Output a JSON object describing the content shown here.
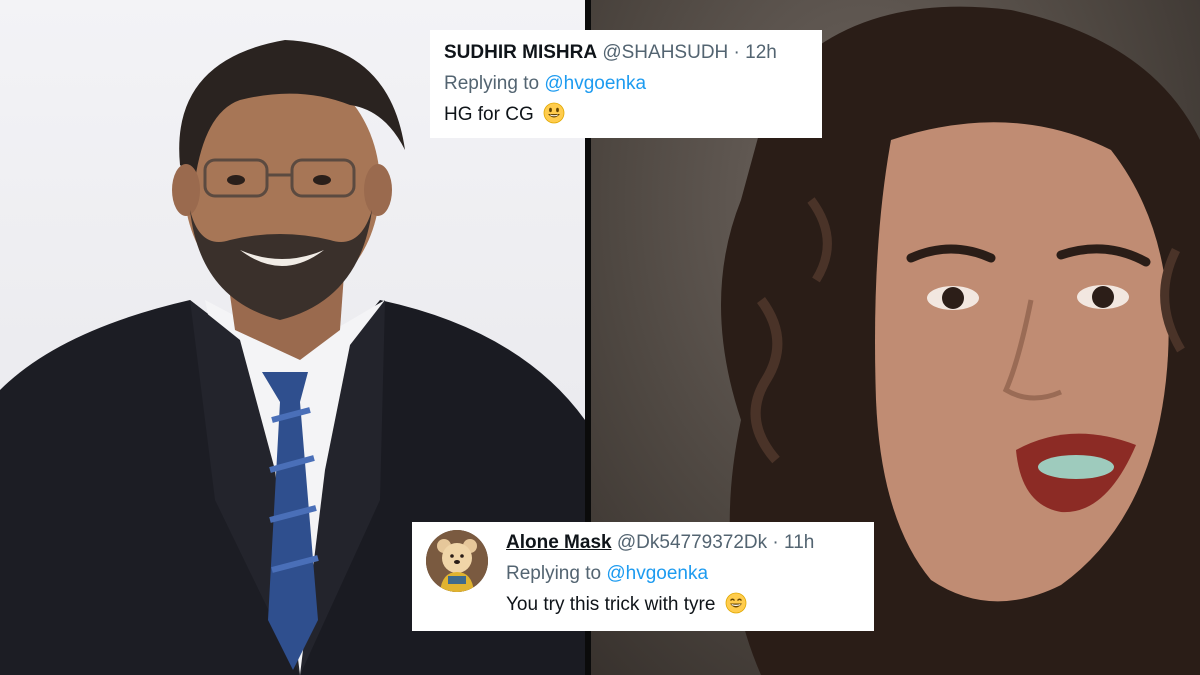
{
  "tweets": [
    {
      "name": "SUDHIR MISHRA",
      "handle": "@SHAHSUDH",
      "separator": "·",
      "time": "12h",
      "reply_prefix": "Replying to",
      "reply_to": "@hvgoenka",
      "text": "HG for CG",
      "emoji": "smiley-face-icon"
    },
    {
      "name": "Alone Mask",
      "handle": "@Dk54779372Dk",
      "separator": "·",
      "time": "11h",
      "reply_prefix": "Replying to",
      "reply_to": "@hvgoenka",
      "text": "You try this trick with tyre",
      "emoji": "grinning-face-icon",
      "avatar": "teddy-bear-avatar"
    }
  ],
  "colors": {
    "mention": "#1d9bf0",
    "secondary_text": "#536471",
    "primary_text": "#0f1419",
    "card_bg": "#ffffff"
  }
}
